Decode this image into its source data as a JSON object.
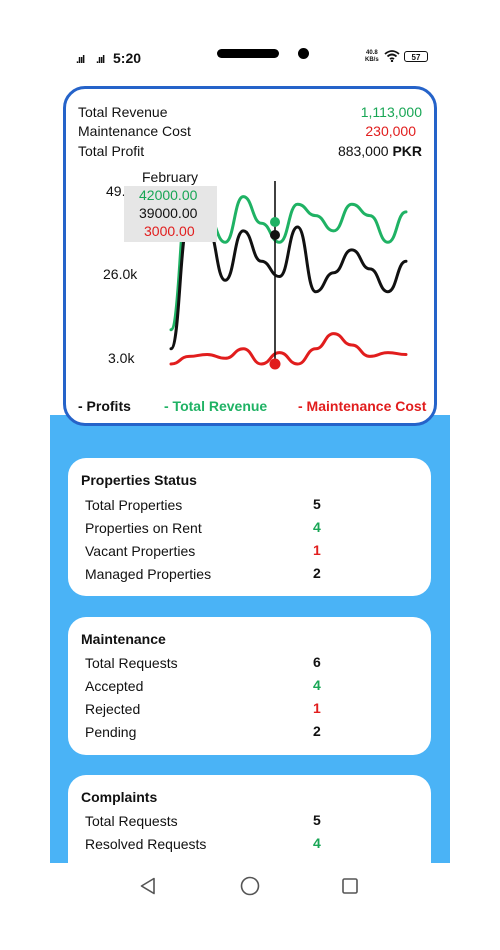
{
  "status_bar": {
    "signal1": ".ııl",
    "signal2": ".ııl",
    "time": "5:20",
    "net_speed_value": "40.8",
    "net_speed_unit": "KB/s",
    "battery": "57"
  },
  "revenue": {
    "total_revenue_label": "Total Revenue",
    "total_revenue_value": "1,113,000",
    "maintenance_label": "Maintenance Cost",
    "maintenance_value": "230,000",
    "profit_label": "Total Profit",
    "profit_value": "883,000",
    "profit_unit": "PKR"
  },
  "chart_data": {
    "type": "line",
    "y_ticks": [
      "49.",
      "26.0k",
      "3.0k"
    ],
    "series": [
      {
        "name": "Total Revenue",
        "color": "#1fb264",
        "values": [
          12000,
          49000,
          42000,
          35000,
          47000,
          40000,
          35000,
          45000,
          42000,
          38000,
          45000,
          42000,
          35000,
          43000
        ]
      },
      {
        "name": "Profits",
        "color": "#111111",
        "values": [
          7000,
          41000,
          39000,
          25000,
          38000,
          30000,
          26000,
          39000,
          22000,
          27000,
          33000,
          28000,
          22000,
          30000
        ]
      },
      {
        "name": "Maintenance Cost",
        "color": "#e11d1d",
        "values": [
          3000,
          5000,
          5500,
          4500,
          7000,
          3000,
          6000,
          3000,
          7000,
          11000,
          8000,
          5000,
          6000,
          5500
        ]
      }
    ],
    "tooltip": {
      "title": "February",
      "revenue": "42000.00",
      "profit": "39000.00",
      "maintenance": "3000.00"
    },
    "legend": [
      "- Profits",
      "- Total Revenue",
      "- Maintenance Cost"
    ]
  },
  "properties": {
    "title": "Properties Status",
    "rows": [
      {
        "label": "Total Properties",
        "value": "5"
      },
      {
        "label": "Properties on Rent",
        "value": "4"
      },
      {
        "label": "Vacant Properties",
        "value": "1"
      },
      {
        "label": "Managed Properties",
        "value": "2"
      }
    ]
  },
  "maintenance": {
    "title": "Maintenance",
    "rows": [
      {
        "label": "Total Requests",
        "value": "6"
      },
      {
        "label": "Accepted",
        "value": "4"
      },
      {
        "label": "Rejected",
        "value": "1"
      },
      {
        "label": "Pending",
        "value": "2"
      }
    ]
  },
  "complaints": {
    "title": "Complaints",
    "rows": [
      {
        "label": "Total Requests",
        "value": "5"
      },
      {
        "label": "Resolved Requests",
        "value": "4"
      }
    ]
  },
  "colors": {
    "accent_blue": "#4ab3f6",
    "card_border": "#2563c9",
    "green": "#18a655",
    "red": "#e11d1d"
  }
}
